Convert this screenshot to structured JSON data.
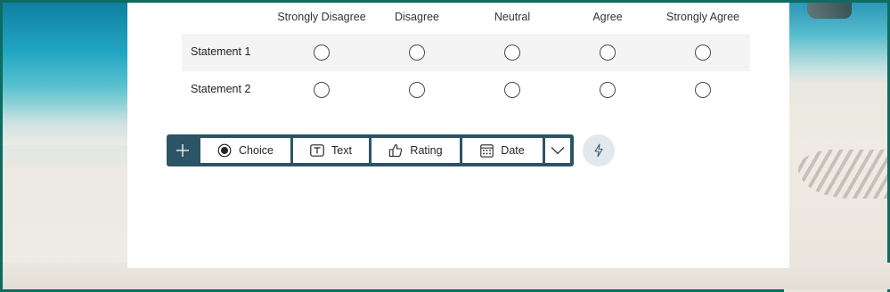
{
  "likert": {
    "columns": [
      "Strongly Disagree",
      "Disagree",
      "Neutral",
      "Agree",
      "Strongly Agree"
    ],
    "rows": [
      {
        "label": "Statement 1"
      },
      {
        "label": "Statement 2"
      }
    ]
  },
  "toolbar": {
    "add_icon": "plus-icon",
    "buttons": [
      {
        "label": "Choice",
        "icon": "radio-choice-icon"
      },
      {
        "label": "Text",
        "icon": "text-box-icon"
      },
      {
        "label": "Rating",
        "icon": "thumbs-up-icon"
      },
      {
        "label": "Date",
        "icon": "calendar-icon"
      }
    ],
    "more_icon": "chevron-down-icon",
    "suggest_icon": "lightning-icon"
  },
  "colors": {
    "toolbar_bg": "#2b5466",
    "row_shade": "#f4f4f4",
    "suggest_bg": "#e1e9ee",
    "frame_border": "#0e6b5f"
  }
}
